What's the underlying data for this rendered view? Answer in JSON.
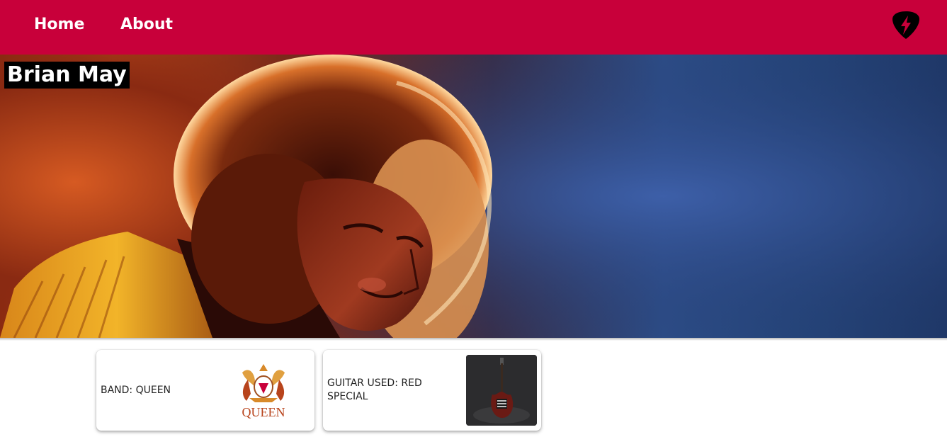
{
  "nav": {
    "home_label": "Home",
    "about_label": "About",
    "pick_icon": "guitar-pick-lightning-icon"
  },
  "hero": {
    "title": "Brian May",
    "image": "brian-may-photo"
  },
  "cards": [
    {
      "text": "BAND: QUEEN",
      "image": "queen-crest-logo",
      "logo_text": "QUEEN"
    },
    {
      "text": "GUITAR USED: RED SPECIAL",
      "image": "red-special-guitar-photo"
    }
  ],
  "colors": {
    "navbar": "#c8003a",
    "nav_text": "#ffffff",
    "title_bg": "#000000",
    "title_text": "#ffffff",
    "card_text": "#222222"
  }
}
